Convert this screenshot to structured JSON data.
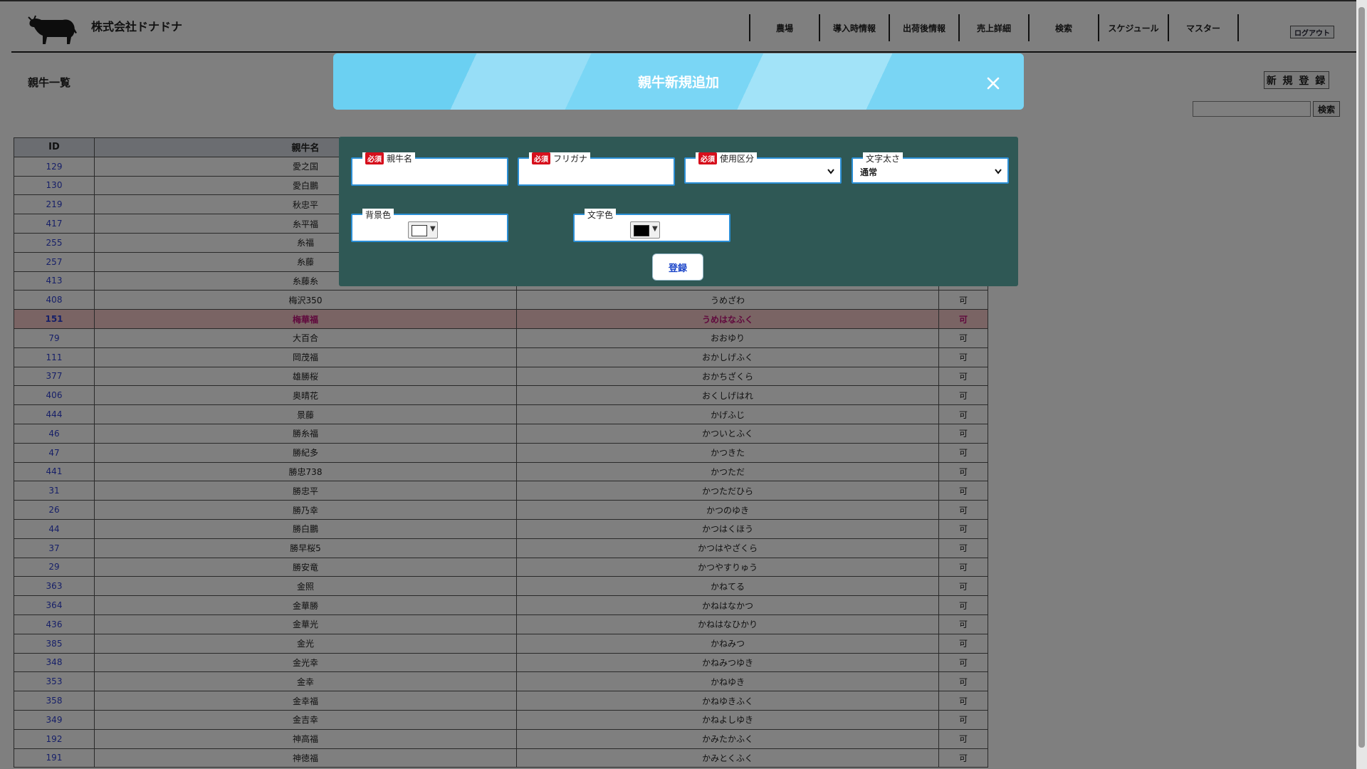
{
  "header": {
    "company": "株式会社ドナドナ",
    "nav": [
      "農場",
      "導入時情報",
      "出荷後情報",
      "売上詳細",
      "検索",
      "スケジュール",
      "マスター"
    ],
    "logout_label": "ログアウト"
  },
  "page": {
    "title": "親牛一覧",
    "new_button": "新 規 登 録",
    "search_button": "検索",
    "search_value": ""
  },
  "table": {
    "headers": [
      "ID",
      "親牛名",
      "",
      ""
    ],
    "rows": [
      [
        "129",
        "愛之国",
        "",
        ""
      ],
      [
        "130",
        "愛白鵬",
        "",
        ""
      ],
      [
        "219",
        "秋忠平",
        "",
        ""
      ],
      [
        "417",
        "糸平福",
        "",
        ""
      ],
      [
        "255",
        "糸福",
        "",
        ""
      ],
      [
        "257",
        "糸藤",
        "",
        ""
      ],
      [
        "413",
        "糸藤糸",
        "",
        ""
      ],
      [
        "408",
        "梅沢350",
        "うめざわ",
        "可"
      ],
      [
        "151",
        "梅華福",
        "うめはなふく",
        "可"
      ],
      [
        "79",
        "大百合",
        "おおゆり",
        "可"
      ],
      [
        "111",
        "岡茂福",
        "おかしげふく",
        "可"
      ],
      [
        "377",
        "雄勝桜",
        "おかちざくら",
        "可"
      ],
      [
        "406",
        "奥晴花",
        "おくしげはれ",
        "可"
      ],
      [
        "444",
        "景藤",
        "かげふじ",
        "可"
      ],
      [
        "46",
        "勝糸福",
        "かついとふく",
        "可"
      ],
      [
        "47",
        "勝紀多",
        "かつきた",
        "可"
      ],
      [
        "441",
        "勝忠738",
        "かつただ",
        "可"
      ],
      [
        "31",
        "勝忠平",
        "かつただひら",
        "可"
      ],
      [
        "26",
        "勝乃幸",
        "かつのゆき",
        "可"
      ],
      [
        "44",
        "勝白鵬",
        "かつはくほう",
        "可"
      ],
      [
        "37",
        "勝早桜5",
        "かつはやざくら",
        "可"
      ],
      [
        "29",
        "勝安竜",
        "かつやすりゅう",
        "可"
      ],
      [
        "363",
        "金照",
        "かねてる",
        "可"
      ],
      [
        "364",
        "金華勝",
        "かねはなかつ",
        "可"
      ],
      [
        "436",
        "金華光",
        "かねはなひかり",
        "可"
      ],
      [
        "385",
        "金光",
        "かねみつ",
        "可"
      ],
      [
        "348",
        "金光幸",
        "かねみつゆき",
        "可"
      ],
      [
        "353",
        "金幸",
        "かねゆき",
        "可"
      ],
      [
        "358",
        "金幸福",
        "かねゆきふく",
        "可"
      ],
      [
        "349",
        "金吉幸",
        "かねよしゆき",
        "可"
      ],
      [
        "192",
        "神高福",
        "かみたかふく",
        "可"
      ],
      [
        "191",
        "神徳福",
        "かみとくふく",
        "可"
      ]
    ],
    "highlight_id": "151"
  },
  "modal": {
    "title": "親牛新規追加",
    "required_badge": "必須",
    "name_label": "親牛名",
    "name_value": "",
    "kana_label": "フリガナ",
    "kana_value": "",
    "usage_label": "使用区分",
    "usage_value": "",
    "weight_label": "文字太さ",
    "weight_value": "通常",
    "bg_label": "背景色",
    "bg_color": "#ffffff",
    "fg_label": "文字色",
    "fg_color": "#000000",
    "submit_label": "登録"
  },
  "colors": {
    "highlight_row": "#f4c8c8",
    "highlight_text": "#c0127a",
    "id_link": "#2d3ed0",
    "modal_body": "#2f5855",
    "field_border": "#2b8fd6"
  }
}
